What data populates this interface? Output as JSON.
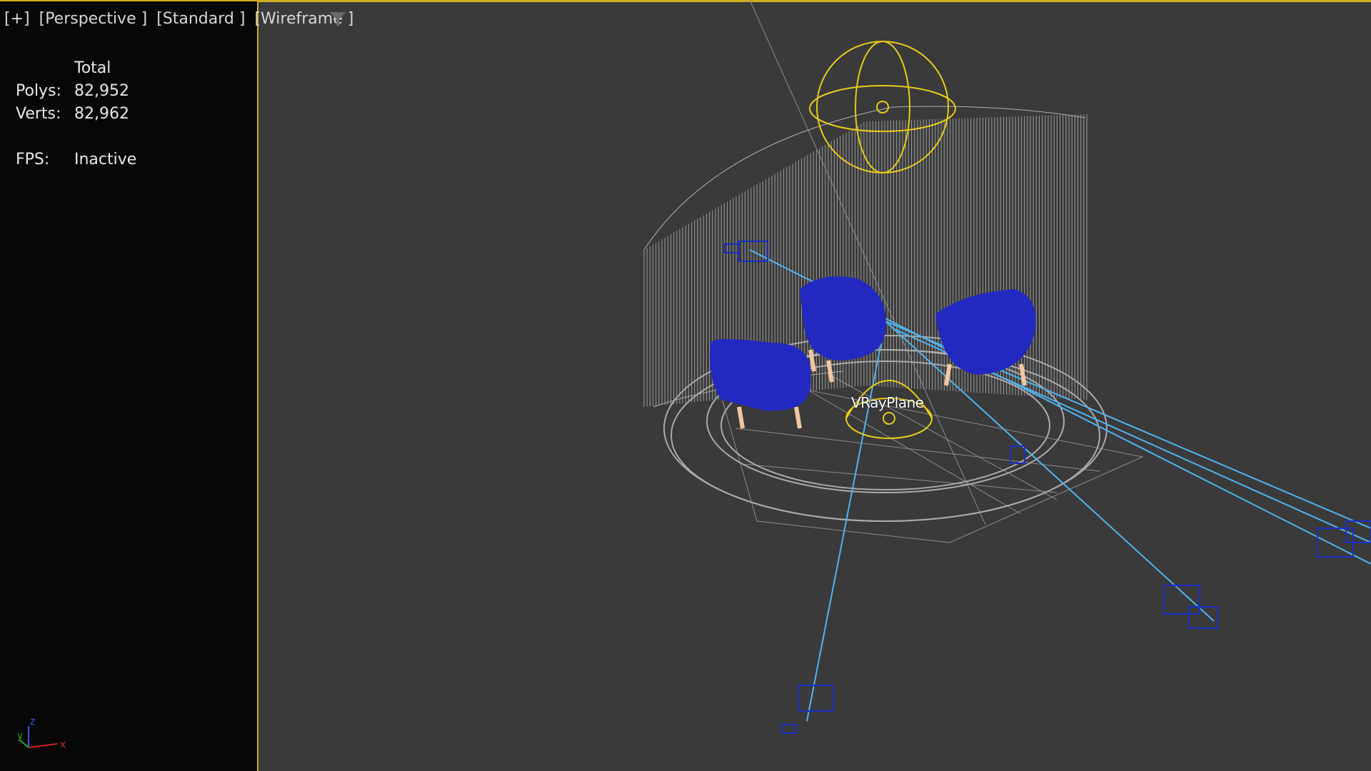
{
  "viewport": {
    "labels": [
      "[+]",
      "[Perspective ]",
      "[Standard ]",
      "[Wireframe ]"
    ],
    "filter_icon": "filter-funnel-icon"
  },
  "stats": {
    "total_label": "Total",
    "polys_label": "Polys:",
    "polys_value": "82,952",
    "verts_label": "Verts:",
    "verts_value": "82,962",
    "fps_label": "FPS:",
    "fps_value": "Inactive"
  },
  "scene": {
    "object_label": "VRayPlane"
  },
  "axis": {
    "x": "x",
    "y": "y",
    "z": "z"
  },
  "colors": {
    "active_border": "#cfae1f",
    "wire_grey": "#9a9a9a",
    "camera_blue": "#1a2fc4",
    "light_line": "#4fb4f0",
    "light_yellow": "#e6cc1a"
  }
}
